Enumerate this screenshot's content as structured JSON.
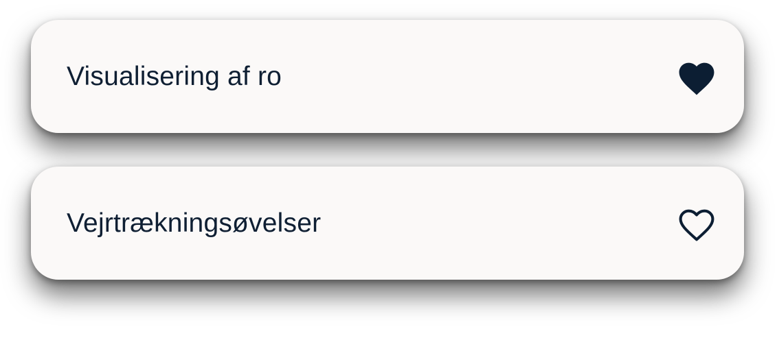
{
  "colors": {
    "card_background": "#FBF9F8",
    "text": "#0F1F33",
    "heart": "#0C1E33"
  },
  "items": [
    {
      "label": "Visualisering af ro",
      "favorite": true,
      "icon": "heart-filled-icon"
    },
    {
      "label": "Vejrtrækningsøvelser",
      "favorite": false,
      "icon": "heart-outline-icon"
    }
  ]
}
